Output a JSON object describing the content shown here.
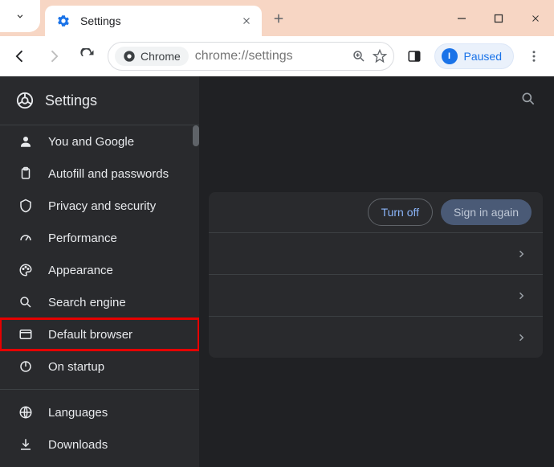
{
  "titlebar": {
    "tab_title": "Settings"
  },
  "toolbar": {
    "chip_label": "Chrome",
    "url": "chrome://settings",
    "profile_initial": "I",
    "profile_label": "Paused"
  },
  "sidebar": {
    "title": "Settings",
    "items": [
      {
        "icon": "person",
        "label": "You and Google"
      },
      {
        "icon": "clipboard",
        "label": "Autofill and passwords"
      },
      {
        "icon": "shield",
        "label": "Privacy and security"
      },
      {
        "icon": "speed",
        "label": "Performance"
      },
      {
        "icon": "palette",
        "label": "Appearance"
      },
      {
        "icon": "search",
        "label": "Search engine"
      },
      {
        "icon": "browser",
        "label": "Default browser"
      },
      {
        "icon": "power",
        "label": "On startup"
      },
      {
        "icon": "globe",
        "label": "Languages"
      },
      {
        "icon": "download",
        "label": "Downloads"
      }
    ],
    "highlighted_index": 6
  },
  "main": {
    "turn_off_label": "Turn off",
    "sign_in_label": "Sign in again"
  }
}
